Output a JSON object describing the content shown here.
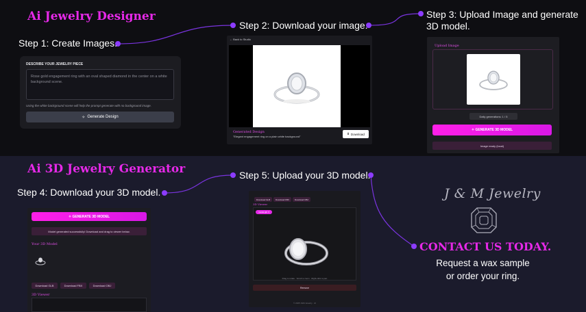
{
  "top": {
    "title": "Ai Jewelry Designer",
    "step1": "Step 1: Create Images.",
    "step2": "Step 2: Download your image.",
    "step3": "Step 3: Upload Image and generate 3D model.",
    "describe_panel": {
      "label": "DESCRIBE YOUR JEWELRY PIECE",
      "prompt_value": "Rose gold engagement ring with an oval shaped diamond in the center on a white background scene.",
      "hint": "Using the white background scene will help the prompt generate with no background image.",
      "generate_label": "Generate Design"
    },
    "result_panel": {
      "back_label": "← Back to Studio",
      "caption_title": "Generated Design",
      "caption_text": "\"Elegant engagement ring on a plain white background\"",
      "download_label": "Download"
    },
    "upload_panel": {
      "title": "Upload Image",
      "daily": "Daily generations: 1 / 5",
      "generate_label": "✧ GENERATE 3D MODEL",
      "status": "Image ready (local)"
    }
  },
  "bottom": {
    "title": "Ai 3D Jewelry Generator",
    "step4": "Step 4: Download your 3D model.",
    "step5": "Step 5: Upload your 3D model.",
    "model_panel": {
      "generate_label": "✧ GENERATE 3D MODEL",
      "success": "Model generated successfully! Download and drag to viewer below.",
      "your_model": "Your 3D Model",
      "dl_glb": "Download GLB",
      "dl_fbx": "Download FBX",
      "dl_obj": "Download OBJ",
      "viewer_title": "3D Viewer"
    },
    "viewer_panel": {
      "dl_glb": "Download GLB",
      "dl_fbx": "Download FBX",
      "dl_obj": "Download OBJ",
      "viewer_title": "3D Viewer",
      "file_chip": "model.glb  ✕",
      "hint": "Drag to rotate · Scroll to zoom · Right-click to pan",
      "remove_label": "Remove",
      "footer": "© 2025 J&M Jewelry · AI"
    },
    "brand": {
      "logo_text": "J & M Jewelry",
      "cta": "CONTACT US TODAY.",
      "line1": "Request a wax sample",
      "line2": "or order your ring."
    }
  },
  "colors": {
    "magenta": "#e629e8",
    "connector": "#8a3cf0",
    "dot": "#8c3cff"
  }
}
